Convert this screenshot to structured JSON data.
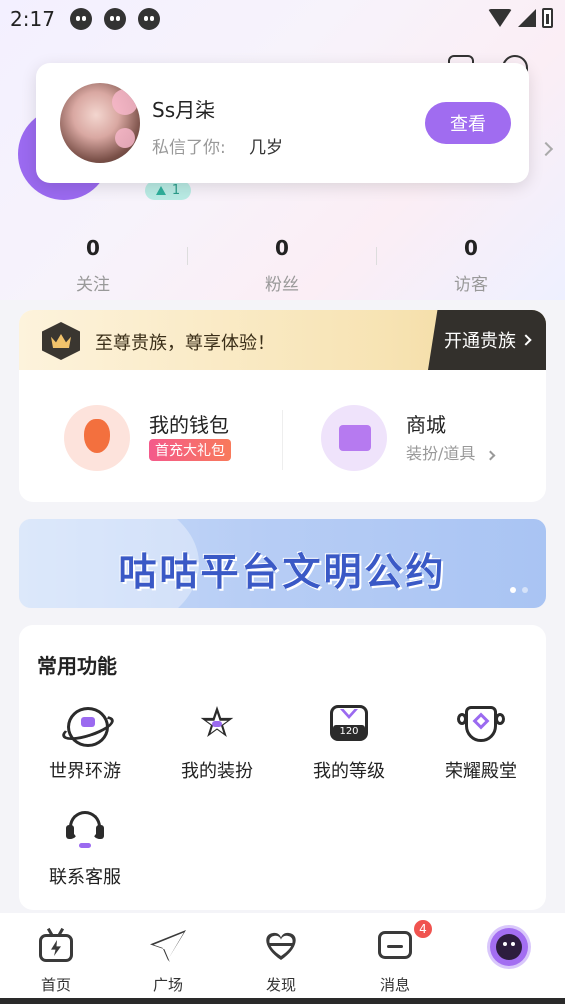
{
  "status_bar": {
    "time": "2:17"
  },
  "popup": {
    "name": "Ss月柒",
    "msg_label": "私信了你:",
    "msg": "几岁",
    "button": "查看"
  },
  "profile": {
    "level": "1"
  },
  "stats": [
    {
      "num": "0",
      "label": "关注"
    },
    {
      "num": "0",
      "label": "粉丝"
    },
    {
      "num": "0",
      "label": "访客"
    }
  ],
  "vip": {
    "text": "至尊贵族，尊享体验！",
    "button": "开通贵族"
  },
  "wallet": {
    "title": "我的钱包",
    "tag": "首充大礼包"
  },
  "mall": {
    "title": "商城",
    "sub": "装扮/道具"
  },
  "banner": {
    "text": "咕咕平台文明公约"
  },
  "functions": {
    "title": "常用功能",
    "items": [
      {
        "label": "世界环游",
        "icon": "planet-icon"
      },
      {
        "label": "我的装扮",
        "icon": "star-icon"
      },
      {
        "label": "我的等级",
        "icon": "level-icon",
        "badge": "120"
      },
      {
        "label": "荣耀殿堂",
        "icon": "honor-icon"
      },
      {
        "label": "联系客服",
        "icon": "headset-icon"
      }
    ]
  },
  "tabs": [
    {
      "label": "首页",
      "icon": "home-tv-icon"
    },
    {
      "label": "广场",
      "icon": "paper-plane-icon"
    },
    {
      "label": "发现",
      "icon": "heart-pulse-icon"
    },
    {
      "label": "消息",
      "icon": "message-icon",
      "badge": "4"
    },
    {
      "label": "",
      "icon": "me-avatar-icon"
    }
  ],
  "colors": {
    "accent": "#a06cf0",
    "badge": "#f0534f",
    "vip_dark": "#33302c"
  }
}
